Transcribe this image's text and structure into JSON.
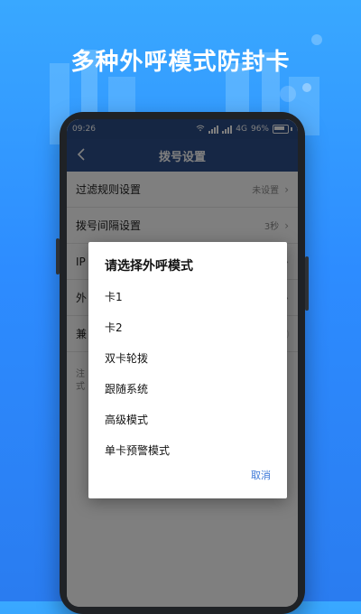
{
  "headline": "多种外呼模式防封卡",
  "status_bar": {
    "time": "09:26",
    "network": "4G",
    "battery_percent": "96%"
  },
  "nav": {
    "title": "拨号设置",
    "back_icon": "chevron-left-icon"
  },
  "settings": {
    "rows": [
      {
        "label": "过滤规则设置",
        "value": "未设置"
      },
      {
        "label": "拨号间隔设置",
        "value": "3秒"
      },
      {
        "label": "IP",
        "value": ""
      },
      {
        "label": "外",
        "value": ""
      },
      {
        "label": "兼",
        "value": ""
      }
    ],
    "note_prefix": "注",
    "note_suffix": "式"
  },
  "dialog": {
    "title": "请选择外呼模式",
    "options": [
      "卡1",
      "卡2",
      "双卡轮拨",
      "跟随系统",
      "高级模式",
      "单卡预警模式"
    ],
    "cancel": "取消"
  },
  "colors": {
    "background": "#2d8cff",
    "status_bar": "#2b4d86",
    "nav_bar": "#2c4f8a",
    "cancel_text": "#3c78d8"
  }
}
